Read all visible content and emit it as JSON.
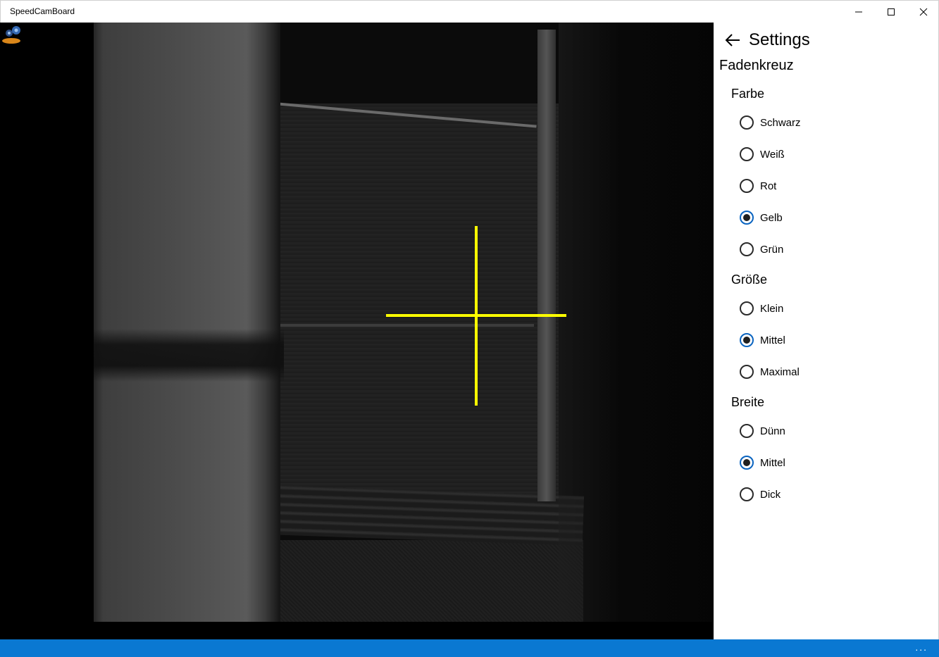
{
  "window": {
    "title": "SpeedCamBoard"
  },
  "colors": {
    "accent": "#0a78d2",
    "crosshair": "#ffff00"
  },
  "settings": {
    "title": "Settings",
    "section": "Fadenkreuz",
    "groups": [
      {
        "title": "Farbe",
        "options": [
          {
            "label": "Schwarz",
            "checked": false
          },
          {
            "label": "Weiß",
            "checked": false
          },
          {
            "label": "Rot",
            "checked": false
          },
          {
            "label": "Gelb",
            "checked": true
          },
          {
            "label": "Grün",
            "checked": false
          }
        ]
      },
      {
        "title": "Größe",
        "options": [
          {
            "label": "Klein",
            "checked": false
          },
          {
            "label": "Mittel",
            "checked": true
          },
          {
            "label": "Maximal",
            "checked": false
          }
        ]
      },
      {
        "title": "Breite",
        "options": [
          {
            "label": "Dünn",
            "checked": false
          },
          {
            "label": "Mittel",
            "checked": true
          },
          {
            "label": "Dick",
            "checked": false
          }
        ]
      }
    ]
  },
  "statusbar": {
    "more_label": "..."
  }
}
